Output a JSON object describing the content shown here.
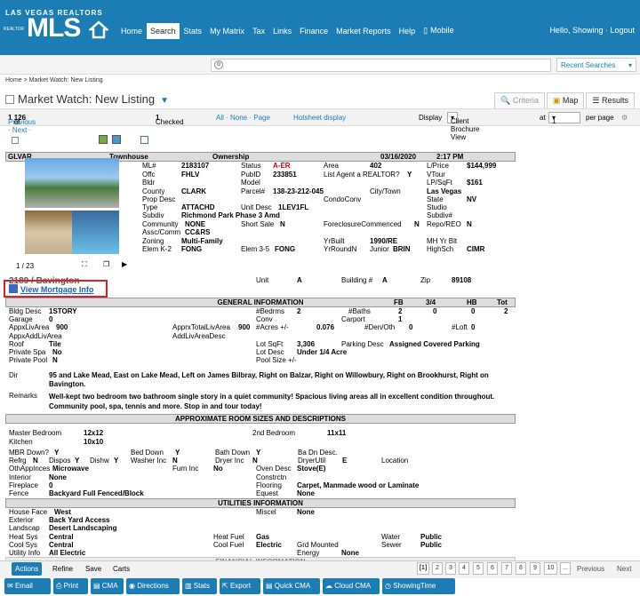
{
  "header": {
    "brand_top": "LAS VEGAS REALTORS",
    "brand_small": "REALTOR",
    "brand_main": "MLS",
    "nav": [
      "Home",
      "Search",
      "Stats",
      "My Matrix",
      "Tax",
      "Links",
      "Finance",
      "Market Reports",
      "Help"
    ],
    "mobile": "Mobile",
    "welcome": "Hello, Showing · Logout"
  },
  "search": {
    "placeholder": "",
    "recent": "Recent Searches"
  },
  "breadcrumb": "Home > Market Watch: New Listing",
  "page_title": "Market Watch: New Listing",
  "tabs": {
    "criteria": "Criteria",
    "map": "Map",
    "results": "Results"
  },
  "results_bar": {
    "nav": "Previous · Next ·",
    "pos": "1",
    "of": "of",
    "total": "126",
    "checked_label": "Checked",
    "checked": "1",
    "select": "All · None · Page",
    "hotsheet": "Hotsheet display",
    "display_label": "Display",
    "display_value": "Client Brochure View",
    "at": "at",
    "per_page_value": "1",
    "per_page": "per page"
  },
  "listing": {
    "area_code": "GLVAR",
    "type": "Townhouse",
    "ownership": "Ownership",
    "date": "03/16/2020",
    "time": "2:17 PM",
    "photo_counter": "1 / 23",
    "address": "2189 / Bavington",
    "mortgage_link": "View Mortgage Info",
    "fields": {
      "ml_lbl": "ML#",
      "ml": "2183107",
      "status_lbl": "Status",
      "status": "A-ER",
      "area_lbl": "Area",
      "area": "402",
      "lprice_lbl": "L/Price",
      "lprice": "$144,999",
      "offc_lbl": "Offc",
      "offc": "FHLV",
      "pubid_lbl": "PubID",
      "pubid": "233851",
      "listagent_lbl": "List Agent a REALTOR?",
      "listagent": "Y",
      "vtour_lbl": "VTour",
      "bldr_lbl": "Bldr",
      "model_lbl": "Model",
      "lpsqft_lbl": "LP/SqFt",
      "lpsqft": "$161",
      "county_lbl": "County",
      "county": "CLARK",
      "parcel_lbl": "Parcel#",
      "parcel": "138-23-212-045",
      "city_lbl": "City/Town",
      "city": "Las Vegas",
      "propdesc_lbl": "Prop Desc",
      "condoconv_lbl": "CondoConv",
      "state_lbl": "State",
      "state": "NV",
      "type_lbl": "Type",
      "type": "ATTACHD",
      "unitdesc_lbl": "Unit Desc",
      "unitdesc": "1LEV1FL",
      "studio_lbl": "Studio",
      "subdiv_lbl": "Subdiv",
      "subdiv": "Richmond Park Phase 3 Amd",
      "subdivnum_lbl": "Subdiv#",
      "community_lbl": "Community",
      "community": "NONE",
      "shortsale_lbl": "Short Sale",
      "shortsale": "N",
      "foreclosure_lbl": "ForeclosureCommenced",
      "foreclosure": "N",
      "repo_lbl": "Repo/REO",
      "repo": "N",
      "assc_lbl": "Assc/Comm",
      "assc": "CC&RS",
      "zoning_lbl": "Zoning",
      "zoning": "Multi-Family",
      "yrbuilt_lbl": "YrBuilt",
      "yrbuilt": "1990/RE",
      "mhyr_lbl": "MH Yr Blt",
      "elemk2_lbl": "Elem K-2",
      "elemk2": "FONG",
      "elem35_lbl": "Elem 3-5",
      "elem35": "FONG",
      "yrround_lbl": "YrRoundN",
      "junior_lbl": "Junior",
      "junior": "BRIN",
      "highsch_lbl": "HighSch",
      "highsch": "CIMR",
      "unit_lbl": "Unit",
      "unit": "A",
      "building_lbl": "Building #",
      "building": "A",
      "zip_lbl": "Zip",
      "zip": "89108"
    }
  },
  "general": {
    "title": "GENERAL INFORMATION",
    "cols": [
      "FB",
      "3/4",
      "HB",
      "Tot"
    ],
    "bldgdesc_lbl": "Bldg Desc",
    "bldgdesc": "1STORY",
    "bedrms_lbl": "#Bedrms",
    "bedrms": "2",
    "baths_lbl": "#Baths",
    "baths": [
      "2",
      "0",
      "0",
      "2"
    ],
    "garage_lbl": "Garage",
    "garage": "0",
    "conv_lbl": "Conv",
    "carport_lbl": "Carport",
    "carport": "1",
    "appxliv_lbl": "AppxLivArea",
    "appxliv": "900",
    "appxtotal_lbl": "ApprxTotalLivArea",
    "appxtotal": "900",
    "acres_lbl": "#Acres +/-",
    "acres": "0.076",
    "denoth_lbl": "#Den/Oth",
    "denoth": "0",
    "loft_lbl": "#Loft",
    "loft": "0",
    "appxaddliv_lbl": "AppxAddLivArea",
    "addlivdesc_lbl": "AddLivAreaDesc",
    "roof_lbl": "Roof",
    "roof": "Tile",
    "lotsqft_lbl": "Lot SqFt",
    "lotsqft": "3,306",
    "parking_lbl": "Parking Desc",
    "parking": "Assigned Covered Parking",
    "privspa_lbl": "Private Spa",
    "privspa": "No",
    "lotdesc_lbl": "Lot Desc",
    "lotdesc": "Under 1/4 Acre",
    "privpool_lbl": "Private Pool",
    "privpool": "N",
    "poolsize_lbl": "Pool Size +/-",
    "dir_lbl": "Dir",
    "dir": "95 and Lake Mead, East on Lake Mead, Left on James Bilbray, Right on Balzar, Right on Willowbury, Right on Brookhurst, Right on Bavington.",
    "remarks_lbl": "Remarks",
    "remarks": "Well-kept two bedroom two bathroom single story in a quiet community! Spacious living areas all in excellent condition throughout. Community pool, spa, tennis and more. Stop in and tour today!"
  },
  "rooms": {
    "title": "APPROXIMATE ROOM SIZES AND DESCRIPTIONS",
    "master_lbl": "Master Bedroom",
    "master": "12x12",
    "second_lbl": "2nd Bedroom",
    "second": "11x11",
    "kitchen_lbl": "Kitchen",
    "kitchen": "10x10",
    "mbr_lbl": "MBR Down?",
    "mbr": "Y",
    "beddown_lbl": "Bed Down",
    "beddown": "Y",
    "bathdown_lbl": "Bath Down",
    "bathdown": "Y",
    "badn_lbl": "Ba Dn Desc.",
    "refrg_lbl": "Refrg",
    "refrg": "N",
    "dispos_lbl": "Dispos",
    "dispos": "Y",
    "dishw_lbl": "Dishw",
    "dishw": "Y",
    "washer_lbl": "Washer Inc",
    "washer": "N",
    "dryer_lbl": "Dryer Inc",
    "dryer": "N",
    "dryerutil_lbl": "DryerUtil",
    "dryerutil": "E",
    "location_lbl": "Location",
    "othappl_lbl": "OthAppInces",
    "othappl": "Microwave",
    "furn_lbl": "Furn Inc",
    "furn": "No",
    "oven_lbl": "Oven Desc",
    "oven": "Stove(E)",
    "interior_lbl": "Interior",
    "interior": "None",
    "constrctn_lbl": "Constrctn",
    "fireplace_lbl": "Fireplace",
    "fireplace": "0",
    "flooring_lbl": "Flooring",
    "flooring": "Carpet, Manmade wood or Laminate",
    "fence_lbl": "Fence",
    "fence": "Backyard Full Fenced/Block",
    "equest_lbl": "Equest",
    "equest": "None"
  },
  "utilities": {
    "title": "UTILITIES INFORMATION",
    "houseface_lbl": "House Face",
    "houseface": "West",
    "miscel_lbl": "Miscel",
    "miscel": "None",
    "exterior_lbl": "Exterior",
    "exterior": "Back Yard Access",
    "landscap_lbl": "Landscap",
    "landscap": "Desert Landscaping",
    "heatsys_lbl": "Heat Sys",
    "heatsys": "Central",
    "heatfuel_lbl": "Heat Fuel",
    "heatfuel": "Gas",
    "water_lbl": "Water",
    "water": "Public",
    "coolsys_lbl": "Cool Sys",
    "coolsys": "Central",
    "coolfuel_lbl": "Cool Fuel",
    "coolfuel": "Electric",
    "grdmounted_lbl": "Grd Mounted",
    "sewer_lbl": "Sewer",
    "sewer": "Public",
    "utilinfo_lbl": "Utility Info",
    "utilinfo": "All Electric",
    "energy_lbl": "Energy",
    "energy": "None",
    "next_section": "FINANCIAL INFORMATION"
  },
  "bottom": {
    "actions": "Actions",
    "refine": "Refine",
    "save": "Save",
    "carts": "Carts",
    "pages": [
      "[1]",
      "2",
      "3",
      "4",
      "5",
      "6",
      "7",
      "8",
      "9",
      "10"
    ],
    "more": "...",
    "previous": "Previous",
    "next": "Next"
  },
  "actionbar": [
    "Email",
    "Print",
    "CMA",
    "Directions",
    "Stats",
    "Export",
    "Quick CMA",
    "Cloud CMA",
    "ShowingTime"
  ]
}
